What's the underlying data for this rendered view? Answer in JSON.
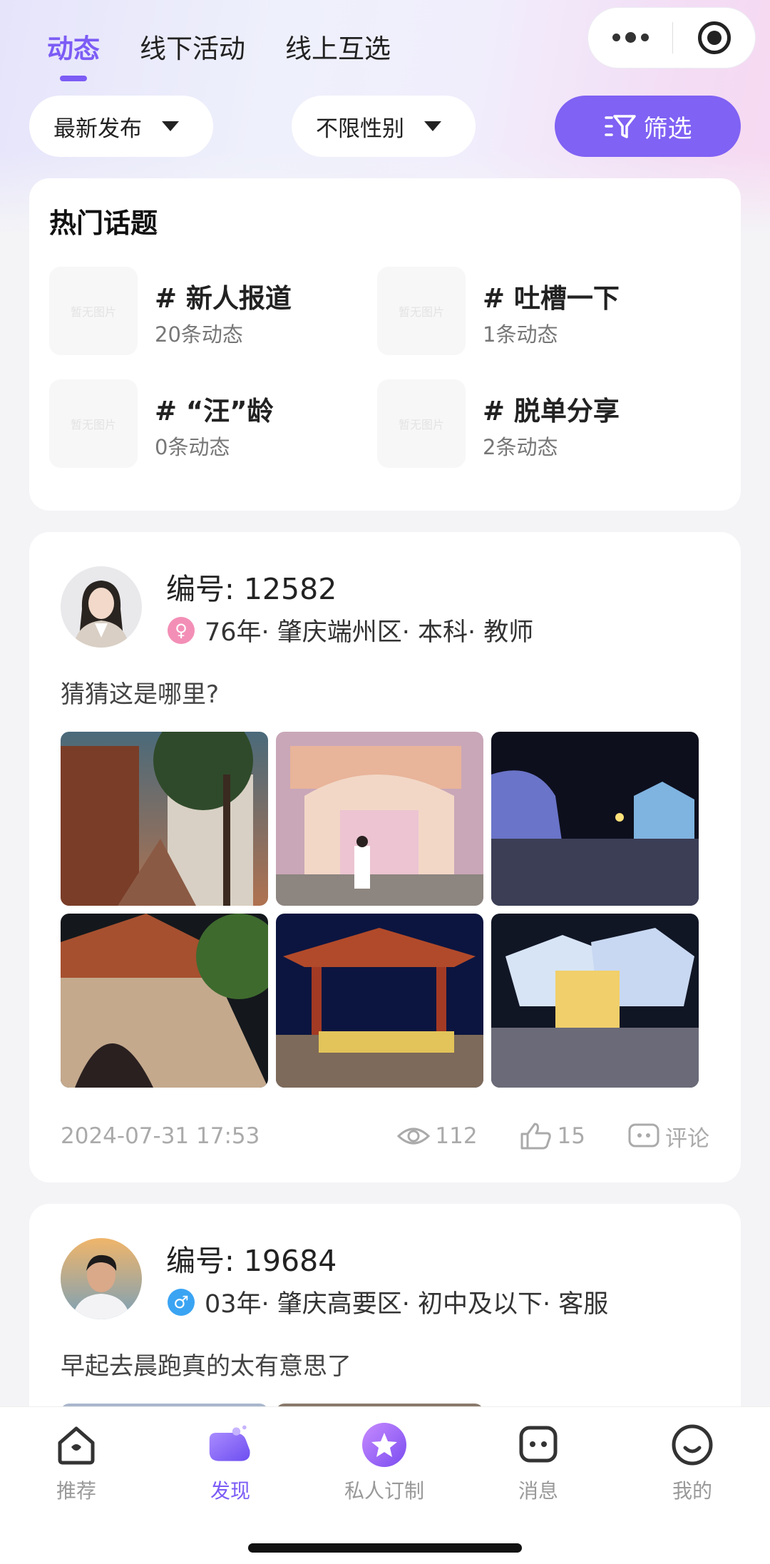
{
  "tabs": [
    {
      "label": "动态",
      "active": true
    },
    {
      "label": "线下活动",
      "active": false
    },
    {
      "label": "线上互选",
      "active": false
    }
  ],
  "filters": {
    "sort": "最新发布",
    "gender": "不限性别",
    "screen_label": "筛选"
  },
  "topics": {
    "title": "热门话题",
    "thumb_placeholder": "暂无图片",
    "items": [
      {
        "name": "# 新人报道",
        "count": "20条动态"
      },
      {
        "name": "# 吐槽一下",
        "count": "1条动态"
      },
      {
        "name": "# “汪”龄",
        "count": "0条动态"
      },
      {
        "name": "# 脱单分享",
        "count": "2条动态"
      }
    ]
  },
  "posts": [
    {
      "id": "编号: 12582",
      "gender": "female",
      "gender_symbol": "♀",
      "info": "76年· 肇庆端州区· 本科· 教师",
      "text": "猜猜这是哪里?",
      "time": "2024-07-31 17:53",
      "views": "112",
      "likes": "15",
      "comment_label": "评论"
    },
    {
      "id": "编号: 19684",
      "gender": "male",
      "gender_symbol": "♂",
      "info": "03年· 肇庆高要区· 初中及以下· 客服",
      "text": "早起去晨跑真的太有意思了"
    }
  ],
  "tabbar": [
    {
      "label": "推荐",
      "icon": "home-icon"
    },
    {
      "label": "发现",
      "icon": "discover-icon",
      "active": true
    },
    {
      "label": "私人订制",
      "icon": "star-badge-icon"
    },
    {
      "label": "消息",
      "icon": "message-icon"
    },
    {
      "label": "我的",
      "icon": "profile-icon"
    }
  ],
  "colors": {
    "accent": "#7c5cf5",
    "button": "#8062f4",
    "female": "#f38fb6",
    "male": "#3aa4f3"
  }
}
